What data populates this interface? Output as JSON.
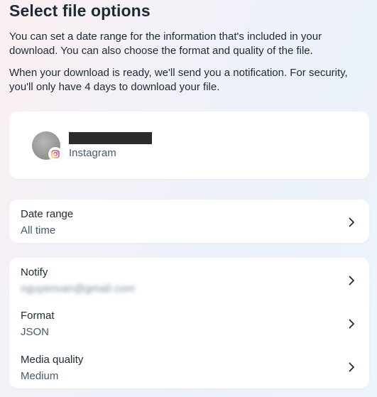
{
  "header": {
    "title": "Select file options",
    "description_1": "You can set a date range for the information that's included in your download. You can also choose the format and quality of the file.",
    "description_2": "When your download is ready, we'll send you a notification. For security, you'll only have 4 days to download your file."
  },
  "account": {
    "platform": "Instagram",
    "avatar_icon": "profile-avatar",
    "badge_icon": "instagram-icon",
    "accent_color": "#d6249f"
  },
  "date_range": {
    "label": "Date range",
    "value": "All time"
  },
  "options": {
    "notify": {
      "label": "Notify",
      "value": "nguyenvan@gmail.com"
    },
    "format": {
      "label": "Format",
      "value": "JSON"
    },
    "media_quality": {
      "label": "Media quality",
      "value": "Medium"
    }
  }
}
